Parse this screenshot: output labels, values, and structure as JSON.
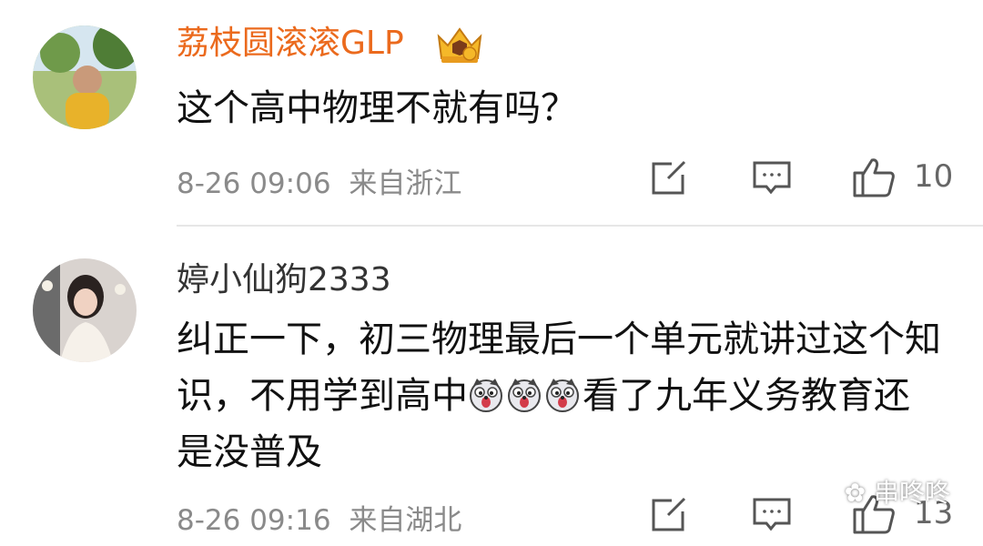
{
  "comments": [
    {
      "username": "荔枝圆滚滚GLP",
      "username_color": "#eb6a1d",
      "badge_icon": "crown-badge-icon",
      "text": "这个高中物理不就有吗？",
      "date": "8-26 09:06",
      "location": "来自浙江",
      "likes": "10"
    },
    {
      "username": "婷小仙狗2333",
      "username_color": "#333333",
      "text_part1": "纠正一下，初三物理最后一个单元就讲过这个知识，不用学到高中",
      "emoji_icon": "husky-dog-face-icon",
      "text_part2": "看了九年义务教育还是没普及",
      "date": "8-26 09:16",
      "location": "来自湖北",
      "likes": "13"
    }
  ],
  "watermark": "串咚咚"
}
